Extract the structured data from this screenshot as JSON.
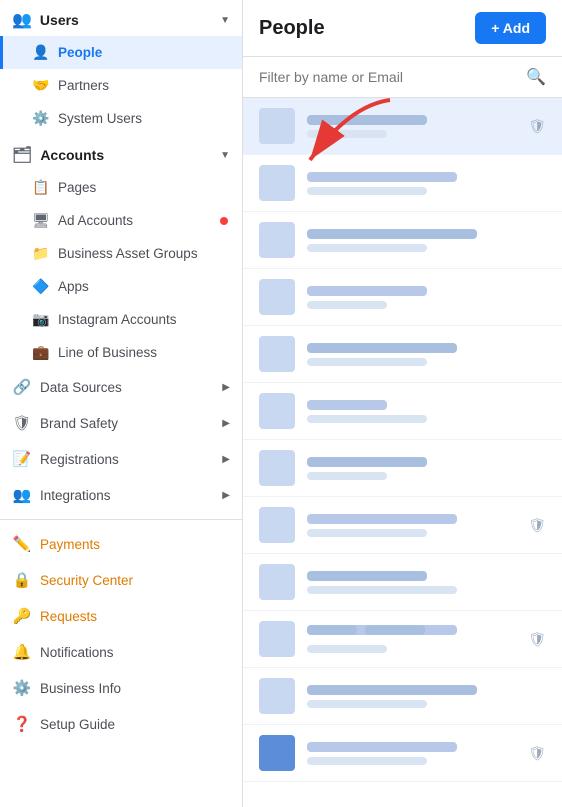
{
  "sidebar": {
    "users_section": {
      "label": "Users",
      "items": [
        {
          "id": "people",
          "label": "People",
          "icon": "👤",
          "active": true
        },
        {
          "id": "partners",
          "label": "Partners",
          "icon": "🤝",
          "active": false
        },
        {
          "id": "system-users",
          "label": "System Users",
          "icon": "⚙️",
          "active": false
        }
      ]
    },
    "accounts_section": {
      "label": "Accounts",
      "items": [
        {
          "id": "pages",
          "label": "Pages",
          "icon": "📋",
          "active": false,
          "has_dot": false
        },
        {
          "id": "ad-accounts",
          "label": "Ad Accounts",
          "icon": "🖥",
          "active": false,
          "has_dot": true
        },
        {
          "id": "business-asset-groups",
          "label": "Business Asset Groups",
          "icon": "📁",
          "active": false,
          "has_dot": false
        },
        {
          "id": "apps",
          "label": "Apps",
          "icon": "🔷",
          "active": false,
          "has_dot": false
        },
        {
          "id": "instagram-accounts",
          "label": "Instagram Accounts",
          "icon": "📷",
          "active": false,
          "has_dot": false
        },
        {
          "id": "line-of-business",
          "label": "Line of Business",
          "icon": "💼",
          "active": false,
          "has_dot": false
        }
      ]
    },
    "expandable_items": [
      {
        "id": "data-sources",
        "label": "Data Sources",
        "icon": "🔗"
      },
      {
        "id": "brand-safety",
        "label": "Brand Safety",
        "icon": "🛡"
      },
      {
        "id": "registrations",
        "label": "Registrations",
        "icon": "📝"
      },
      {
        "id": "integrations",
        "label": "Integrations",
        "icon": "👥"
      }
    ],
    "bottom_items": [
      {
        "id": "payments",
        "label": "Payments",
        "icon": "✏️",
        "color": "orange"
      },
      {
        "id": "security-center",
        "label": "Security Center",
        "icon": "🔒",
        "color": "orange"
      },
      {
        "id": "requests",
        "label": "Requests",
        "icon": "🔑",
        "color": "orange"
      },
      {
        "id": "notifications",
        "label": "Notifications",
        "icon": "🔔",
        "color": "dark"
      },
      {
        "id": "business-info",
        "label": "Business Info",
        "icon": "⚙️",
        "color": "dark"
      },
      {
        "id": "setup-guide",
        "label": "Setup Guide",
        "icon": "❓",
        "color": "dark"
      }
    ]
  },
  "main": {
    "title": "People",
    "add_button_label": "+ Add",
    "search_placeholder": "Filter by name or Email",
    "rows": [
      {
        "id": 1,
        "has_shield": true,
        "highlighted": true
      },
      {
        "id": 2,
        "has_shield": false,
        "highlighted": false
      },
      {
        "id": 3,
        "has_shield": false,
        "highlighted": false
      },
      {
        "id": 4,
        "has_shield": false,
        "highlighted": false
      },
      {
        "id": 5,
        "has_shield": false,
        "highlighted": false
      },
      {
        "id": 6,
        "has_shield": false,
        "highlighted": false
      },
      {
        "id": 7,
        "has_shield": false,
        "highlighted": false
      },
      {
        "id": 8,
        "has_shield": true,
        "highlighted": false
      },
      {
        "id": 9,
        "has_shield": false,
        "highlighted": false
      },
      {
        "id": 10,
        "has_shield": false,
        "highlighted": false
      },
      {
        "id": 11,
        "has_shield": true,
        "highlighted": false
      },
      {
        "id": 12,
        "has_shield": false,
        "highlighted": false
      },
      {
        "id": 13,
        "has_shield": true,
        "highlighted": false
      }
    ]
  }
}
